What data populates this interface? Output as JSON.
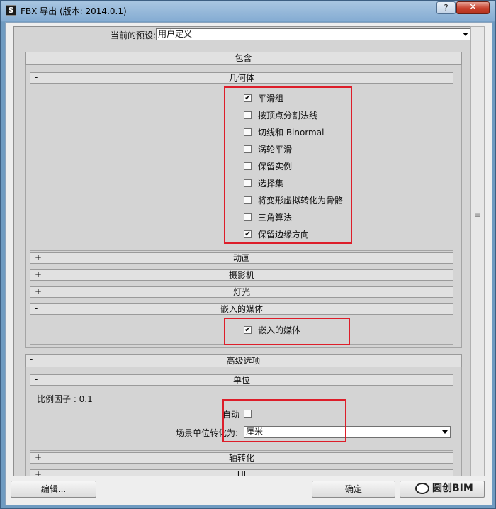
{
  "window": {
    "title": "FBX 导出 (版本: 2014.0.1)",
    "help_label": "?",
    "close_label": "✕"
  },
  "preset": {
    "label": "当前的预设:",
    "value": "用户定义"
  },
  "sections": {
    "include": {
      "sign": "-",
      "title": "包含"
    },
    "geometry": {
      "sign": "-",
      "title": "几何体",
      "options": [
        {
          "label": "平滑组",
          "checked": true
        },
        {
          "label": "按顶点分割法线",
          "checked": false
        },
        {
          "label": "切线和 Binormal",
          "checked": false
        },
        {
          "label": "涡轮平滑",
          "checked": false
        },
        {
          "label": "保留实例",
          "checked": false
        },
        {
          "label": "选择集",
          "checked": false
        },
        {
          "label": "将变形虚拟转化为骨骼",
          "checked": false
        },
        {
          "label": "三角算法",
          "checked": false
        },
        {
          "label": "保留边缘方向",
          "checked": true
        }
      ]
    },
    "animation": {
      "sign": "+",
      "title": "动画"
    },
    "camera": {
      "sign": "+",
      "title": "摄影机"
    },
    "light": {
      "sign": "+",
      "title": "灯光"
    },
    "embed_media": {
      "sign": "-",
      "title": "嵌入的媒体",
      "option": {
        "label": "嵌入的媒体",
        "checked": true
      }
    },
    "advanced": {
      "sign": "-",
      "title": "高级选项"
    },
    "units": {
      "sign": "-",
      "title": "单位",
      "scale_factor": "比例因子 : 0.1",
      "auto_label": "自动",
      "auto_checked": false,
      "convert_label": "场景单位转化为:",
      "convert_value": "厘米"
    },
    "axis": {
      "sign": "+",
      "title": "轴转化"
    },
    "ui": {
      "sign": "+",
      "title": "UI"
    }
  },
  "footer": {
    "edit_label": "编辑...",
    "ok_label": "确定"
  },
  "watermark": {
    "text": "圆创BIM"
  },
  "colors": {
    "highlight_red": "#dd1e2a",
    "titlebar": "#86add3"
  }
}
